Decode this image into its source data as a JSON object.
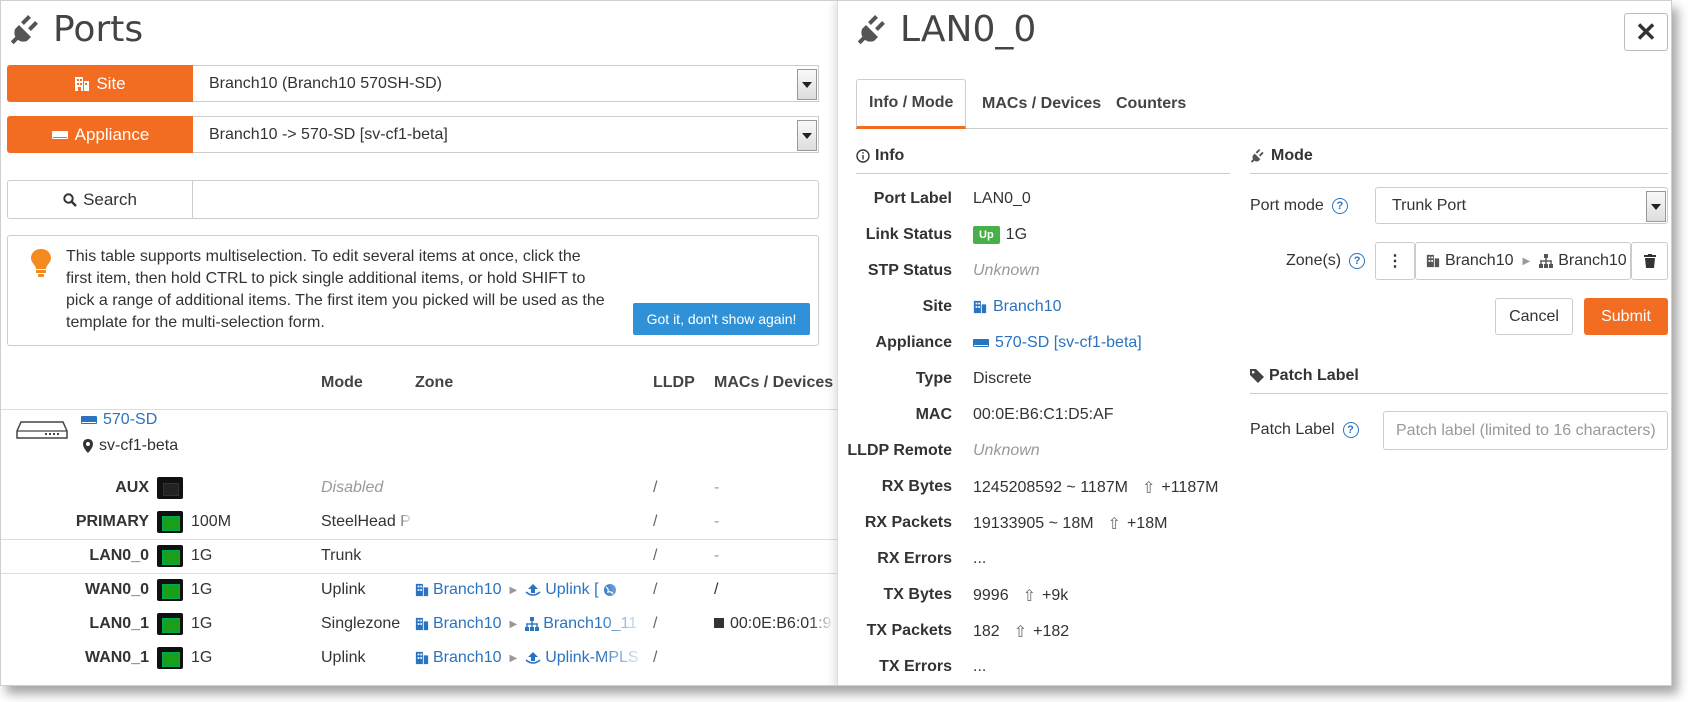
{
  "left": {
    "title": "Ports",
    "site": {
      "label": "Site",
      "value": "Branch10 (Branch10 570SH-SD)"
    },
    "appliance": {
      "label": "Appliance",
      "value": "Branch10 -> 570-SD [sv-cf1-beta]"
    },
    "search": {
      "label": "Search",
      "value": ""
    },
    "tip": {
      "text": "This table supports multiselection. To edit several items at once, click the first item, then hold CTRL to pick single additional items, or hold SHIFT to pick a range of additional items. The first item you picked will be used as the template for the multi-selection form.",
      "button": "Got it, don't show again!"
    },
    "columns": [
      "Mode",
      "Zone",
      "LLDP",
      "MACs / Devices"
    ],
    "appliance_name": "570-SD",
    "location": "sv-cf1-beta",
    "ports": [
      {
        "name": "AUX",
        "speed": "",
        "mode": "Disabled",
        "zone_site": "",
        "zone_name": "",
        "lldp": "/",
        "macs": "-"
      },
      {
        "name": "PRIMARY",
        "speed": "100M",
        "mode": "SteelHead P",
        "zone_site": "",
        "zone_name": "",
        "lldp": "/",
        "macs": "-"
      },
      {
        "name": "LAN0_0",
        "speed": "1G",
        "mode": "Trunk",
        "zone_site": "",
        "zone_name": "",
        "lldp": "/",
        "macs": "-"
      },
      {
        "name": "WAN0_0",
        "speed": "1G",
        "mode": "Uplink",
        "zone_site": "Branch10",
        "zone_name": "Uplink [",
        "lldp": "/",
        "macs": "/"
      },
      {
        "name": "LAN0_1",
        "speed": "1G",
        "mode": "Singlezone",
        "zone_site": "Branch10",
        "zone_name": "Branch10_11",
        "lldp": "/",
        "macs": "00:0E:B6:01:9"
      },
      {
        "name": "WAN0_1",
        "speed": "1G",
        "mode": "Uplink",
        "zone_site": "Branch10",
        "zone_name": "Uplink-MPLS",
        "lldp": "/",
        "macs": ""
      }
    ]
  },
  "right": {
    "title": "LAN0_0",
    "tabs": [
      "Info / Mode",
      "MACs / Devices",
      "Counters"
    ],
    "info_heading": "Info",
    "info": [
      {
        "k": "Port Label",
        "v": "LAN0_0"
      },
      {
        "k": "Link Status",
        "v": "1G",
        "badge": "Up"
      },
      {
        "k": "STP Status",
        "v": "Unknown"
      },
      {
        "k": "Site",
        "v": "Branch10"
      },
      {
        "k": "Appliance",
        "v": "570-SD [sv-cf1-beta]"
      },
      {
        "k": "Type",
        "v": "Discrete"
      },
      {
        "k": "MAC",
        "v": "00:0E:B6:C1:D5:AF"
      },
      {
        "k": "LLDP Remote",
        "v": "Unknown"
      },
      {
        "k": "RX Bytes",
        "v": "1245208592 ~ 1187M",
        "delta": "+1187M"
      },
      {
        "k": "RX Packets",
        "v": "19133905 ~ 18M",
        "delta": "+18M"
      },
      {
        "k": "RX Errors",
        "v": "..."
      },
      {
        "k": "TX Bytes",
        "v": "9996",
        "delta": "+9k"
      },
      {
        "k": "TX Packets",
        "v": "182",
        "delta": "+182"
      },
      {
        "k": "TX Errors",
        "v": "..."
      }
    ],
    "mode_heading": "Mode",
    "port_mode_label": "Port mode",
    "port_mode_value": "Trunk Port",
    "zones_label": "Zone(s)",
    "zone_site": "Branch10",
    "zone_name": "Branch10",
    "cancel": "Cancel",
    "submit": "Submit",
    "patch_heading": "Patch Label",
    "patch_label": "Patch Label",
    "patch_placeholder": "Patch label (limited to 16 characters)"
  },
  "colors": {
    "accent": "#f26d21",
    "link": "#2a73c0",
    "ok": "#48b04b"
  }
}
